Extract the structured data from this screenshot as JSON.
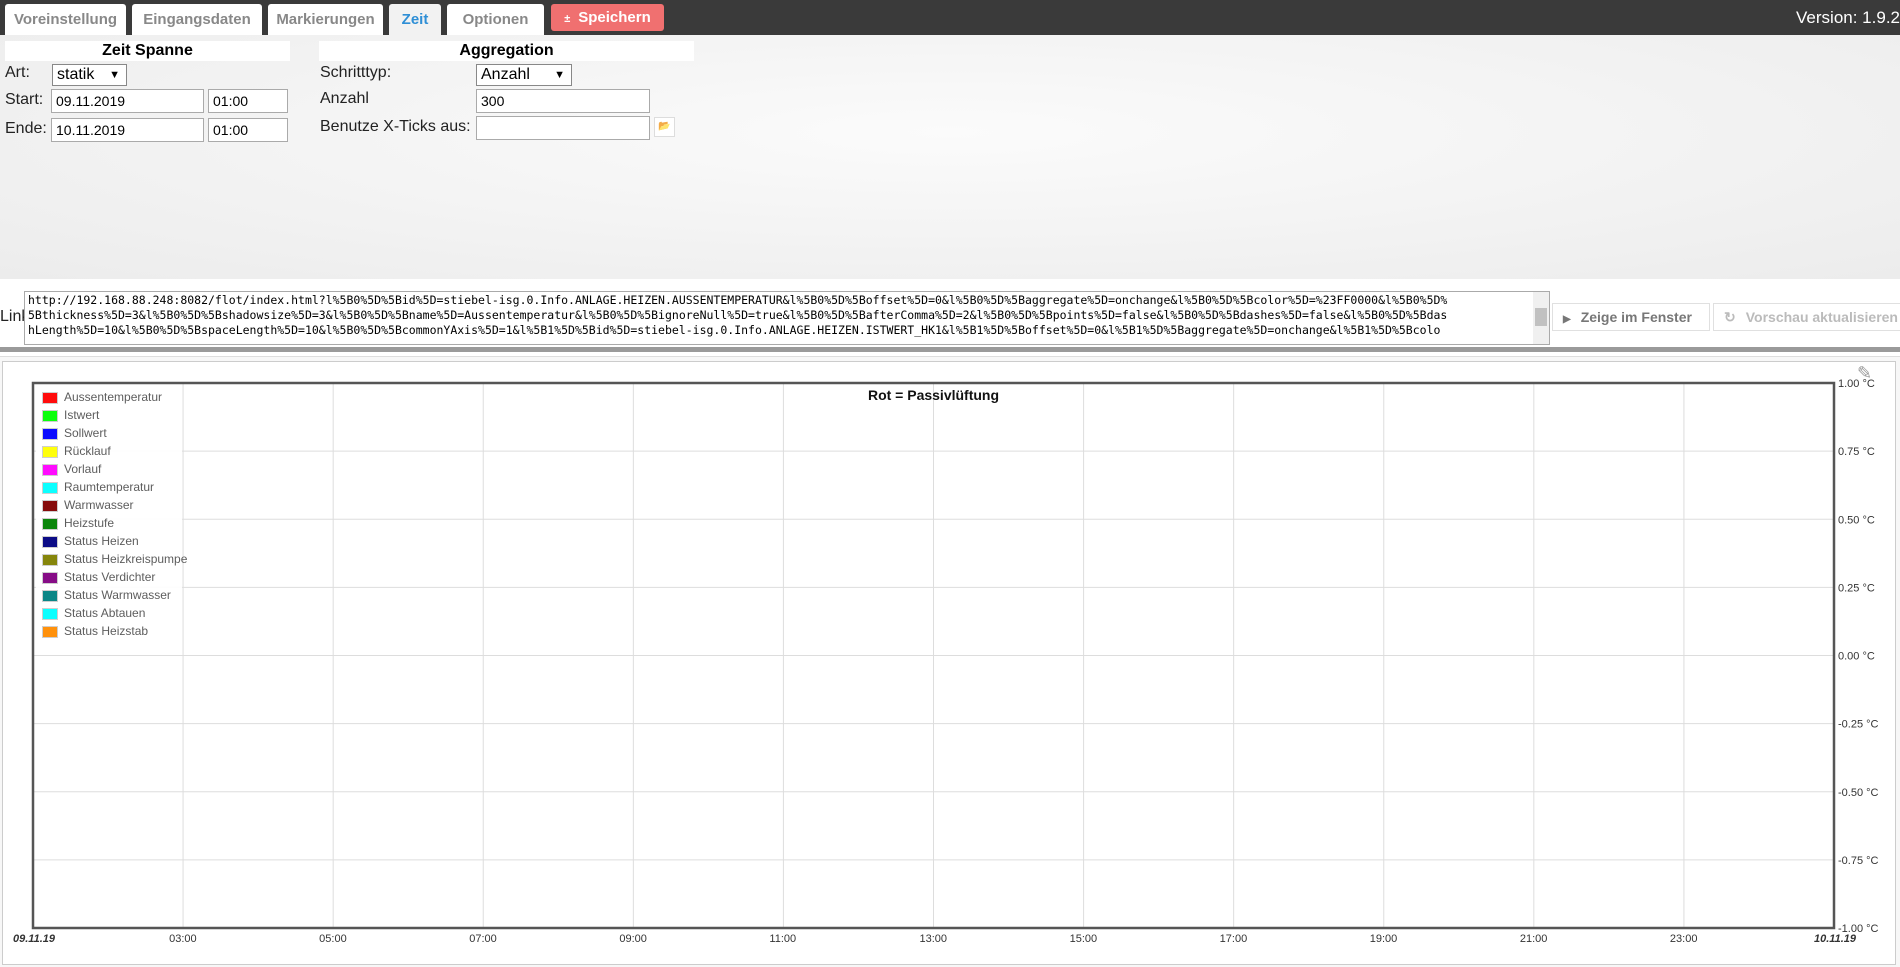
{
  "tabs": [
    {
      "label": "Voreinstellung"
    },
    {
      "label": "Eingangsdaten"
    },
    {
      "label": "Markierungen"
    },
    {
      "label": "Zeit",
      "active": true
    },
    {
      "label": "Optionen"
    }
  ],
  "save_label": "Speichern",
  "save_icon": "upload-icon",
  "version": "Version: 1.9.2",
  "zeit": {
    "title": "Zeit Spanne",
    "art_label": "Art:",
    "art_value": "statik",
    "start_label": "Start:",
    "start_date": "09.11.2019",
    "start_time": "01:00",
    "end_label": "Ende:",
    "end_date": "10.11.2019",
    "end_time": "01:00"
  },
  "aggregation": {
    "title": "Aggregation",
    "step_label": "Schritttyp:",
    "step_value": "Anzahl",
    "count_label": "Anzahl",
    "count_value": "300",
    "xticks_label": "Benutze X-Ticks aus:",
    "xticks_value": ""
  },
  "link": {
    "label": "Link",
    "lines": [
      "http://192.168.88.248:8082/flot/index.html?l%5B0%5D%5Bid%5D=stiebel-isg.0.Info.ANLAGE.HEIZEN.AUSSENTEMPERATUR&l%5B0%5D%5Boffset%5D=0&l%5B0%5D%5Baggregate%5D=onchange&l%5B0%5D%5Bcolor%5D=%23FF0000&l%5B0%5D%",
      "5Bthickness%5D=3&l%5B0%5D%5Bshadowsize%5D=3&l%5B0%5D%5Bname%5D=Aussentemperatur&l%5B0%5D%5BignoreNull%5D=true&l%5B0%5D%5BafterComma%5D=2&l%5B0%5D%5Bpoints%5D=false&l%5B0%5D%5Bdashes%5D=false&l%5B0%5D%5Bdas",
      "hLength%5D=10&l%5B0%5D%5BspaceLength%5D=10&l%5B0%5D%5BcommonYAxis%5D=1&l%5B1%5D%5Bid%5D=stiebel-isg.0.Info.ANLAGE.HEIZEN.ISTWERT_HK1&l%5B1%5D%5Boffset%5D=0&l%5B1%5D%5Baggregate%5D=onchange&l%5B1%5D%5Bcolo"
    ]
  },
  "buttons": {
    "show_window": "Zeige im Fenster",
    "refresh_preview": "Vorschau aktualisieren"
  },
  "chart_data": {
    "type": "line",
    "title": "Rot = Passivlüftung",
    "x_tick_labels": [
      "09.11.19",
      "03:00",
      "05:00",
      "07:00",
      "09:00",
      "11:00",
      "13:00",
      "15:00",
      "17:00",
      "19:00",
      "21:00",
      "23:00",
      "10.11.19"
    ],
    "x_range": [
      "09.11.2019 01:00",
      "10.11.2019 01:00"
    ],
    "y_tick_labels": [
      "1.00 °C",
      "0.75 °C",
      "0.50 °C",
      "0.25 °C",
      "0.00 °C",
      "-0.25 °C",
      "-0.50 °C",
      "-0.75 °C",
      "-1.00 °C"
    ],
    "ylim": [
      -1,
      1
    ],
    "grid": true,
    "legend_position": "top-left",
    "series": [
      {
        "name": "Aussentemperatur",
        "color": "#FF0000",
        "values": []
      },
      {
        "name": "Istwert",
        "color": "#00FF00",
        "values": []
      },
      {
        "name": "Sollwert",
        "color": "#0000FF",
        "values": []
      },
      {
        "name": "Rücklauf",
        "color": "#FFFF00",
        "values": []
      },
      {
        "name": "Vorlauf",
        "color": "#FF00FF",
        "values": []
      },
      {
        "name": "Raumtemperatur",
        "color": "#00FFFF",
        "values": []
      },
      {
        "name": "Warmwasser",
        "color": "#800000",
        "values": []
      },
      {
        "name": "Heizstufe",
        "color": "#008000",
        "values": []
      },
      {
        "name": "Status Heizen",
        "color": "#000080",
        "values": []
      },
      {
        "name": "Status Heizkreispumpe",
        "color": "#808000",
        "values": []
      },
      {
        "name": "Status Verdichter",
        "color": "#800080",
        "values": []
      },
      {
        "name": "Status Warmwasser",
        "color": "#008080",
        "values": []
      },
      {
        "name": "Status Abtauen",
        "color": "#00FFFF",
        "values": []
      },
      {
        "name": "Status Heizstab",
        "color": "#FF8C00",
        "values": []
      }
    ]
  }
}
